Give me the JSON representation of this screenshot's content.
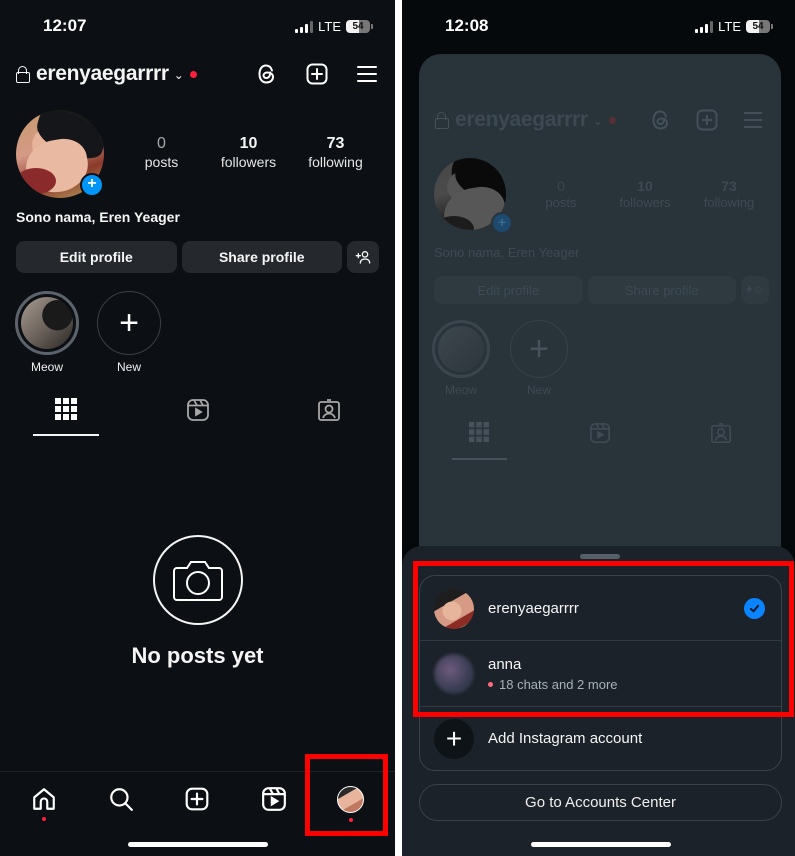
{
  "left": {
    "status": {
      "time": "12:07",
      "network": "LTE",
      "battery": "54"
    },
    "header": {
      "username": "erenyaegarrrr",
      "icons": [
        "threads-icon",
        "create-icon",
        "menu-icon"
      ]
    },
    "profile": {
      "stats": [
        {
          "value": "0",
          "label": "posts"
        },
        {
          "value": "10",
          "label": "followers"
        },
        {
          "value": "73",
          "label": "following"
        }
      ],
      "bio": "Sono nama, Eren Yeager",
      "buttons": {
        "edit": "Edit profile",
        "share": "Share profile",
        "discover_icon": "add-person-icon"
      }
    },
    "highlights": [
      {
        "label": "Meow"
      },
      {
        "label": "New",
        "icon": "+"
      }
    ],
    "tabs": [
      "grid-icon",
      "reels-icon",
      "tagged-icon"
    ],
    "empty": {
      "title": "No posts yet"
    },
    "bottom_nav": [
      "home-icon",
      "search-icon",
      "create-icon",
      "reels-icon",
      "profile-avatar"
    ],
    "annotation": "profile tab highlighted"
  },
  "right": {
    "status": {
      "time": "12:08",
      "network": "LTE",
      "battery": "54"
    },
    "background": {
      "username": "erenyaegarrrr",
      "stats": [
        {
          "value": "0",
          "label": "posts"
        },
        {
          "value": "10",
          "label": "followers"
        },
        {
          "value": "73",
          "label": "following"
        }
      ],
      "bio": "Sono nama, Eren Yeager",
      "buttons": {
        "edit": "Edit profile",
        "share": "Share profile"
      },
      "highlights": [
        {
          "label": "Meow"
        },
        {
          "label": "New",
          "icon": "+"
        }
      ]
    },
    "sheet": {
      "accounts": [
        {
          "username": "erenyaegarrrr",
          "selected": true
        },
        {
          "username": "anna",
          "subtitle": "18 chats and 2 more",
          "has_dot": true
        }
      ],
      "add_account": "Add Instagram account",
      "accounts_center": "Go to Accounts Center",
      "check_color": "#0a84ff"
    }
  },
  "colors": {
    "bg": "#0c0f14",
    "accent": "#0095f6",
    "notification": "#ff1f3d",
    "annotation": "#ff0000"
  }
}
